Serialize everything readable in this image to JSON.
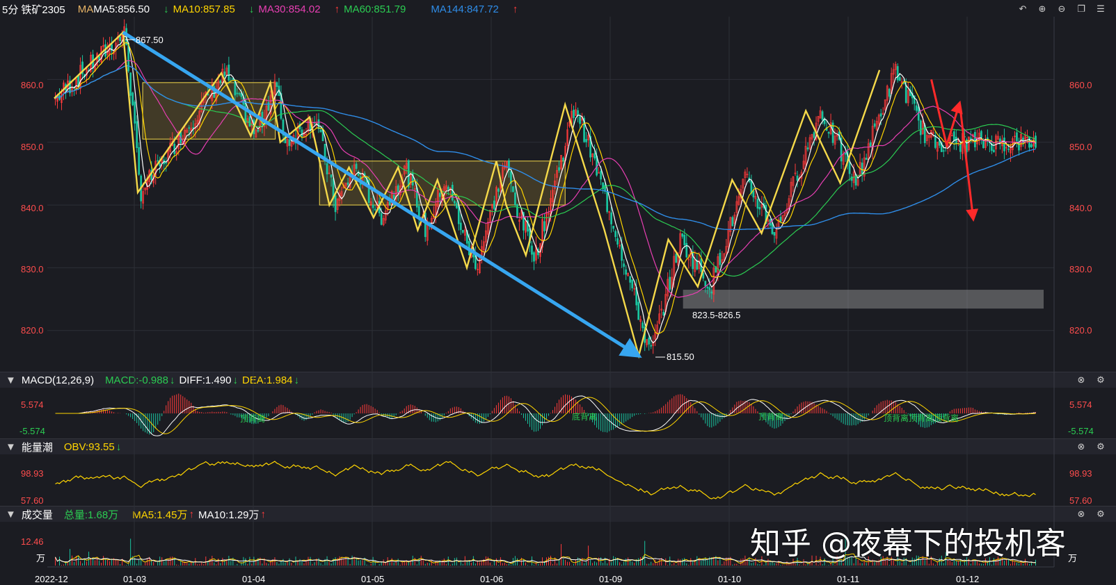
{
  "main_header": {
    "period": "5分",
    "symbol": "铁矿2305",
    "ma_prefix": "MA",
    "ma5": "MA5:856.50",
    "ma10": "MA10:857.85",
    "ma30": "MA30:854.02",
    "ma60": "MA60:851.79",
    "ma144": "MA144:847.72",
    "down_arrow": "↓",
    "up_arrow": "↑"
  },
  "price_axis": {
    "ticks": [
      "860.0",
      "850.0",
      "840.0",
      "830.0",
      "820.0"
    ],
    "tick_values": [
      860,
      850,
      840,
      830,
      820
    ],
    "range": [
      814,
      870
    ]
  },
  "annotations": {
    "high_label": "867.50",
    "low_label": "815.50",
    "zone_label": "823.5-826.5"
  },
  "macd": {
    "title": "MACD(12,26,9)",
    "macd": "MACD:-0.988",
    "diff": "DIFF:1.490",
    "dea": "DEA:1.984",
    "upper": "5.574",
    "lower": "-5.574",
    "divergence_labels": [
      "顶背离",
      "底背离",
      "顶背离",
      "顶背离顶背离顶背离"
    ]
  },
  "obv": {
    "title": "能量潮",
    "value": "OBV:93.55",
    "upper": "98.93",
    "lower": "57.60"
  },
  "volume": {
    "title": "成交量",
    "total": "总量:1.68万",
    "ma5": "MA5:1.45万",
    "ma10": "MA10:1.29万",
    "upper": "12.46",
    "unit": "万"
  },
  "date_axis": [
    "2022-12",
    "01-03",
    "01-04",
    "01-05",
    "01-06",
    "01-09",
    "01-10",
    "01-11",
    "01-12"
  ],
  "watermark": "知乎 @夜幕下的投机客",
  "colors": {
    "up": "#ff3b3b",
    "down": "#19c5a0",
    "ma5": "#ffffff",
    "ma10": "#ffd500",
    "ma30": "#e83fb3",
    "ma60": "#2bcc52",
    "ma144": "#2f8de8",
    "zigzag": "#f5d94a",
    "trend_arrow": "#37a6f0"
  }
}
